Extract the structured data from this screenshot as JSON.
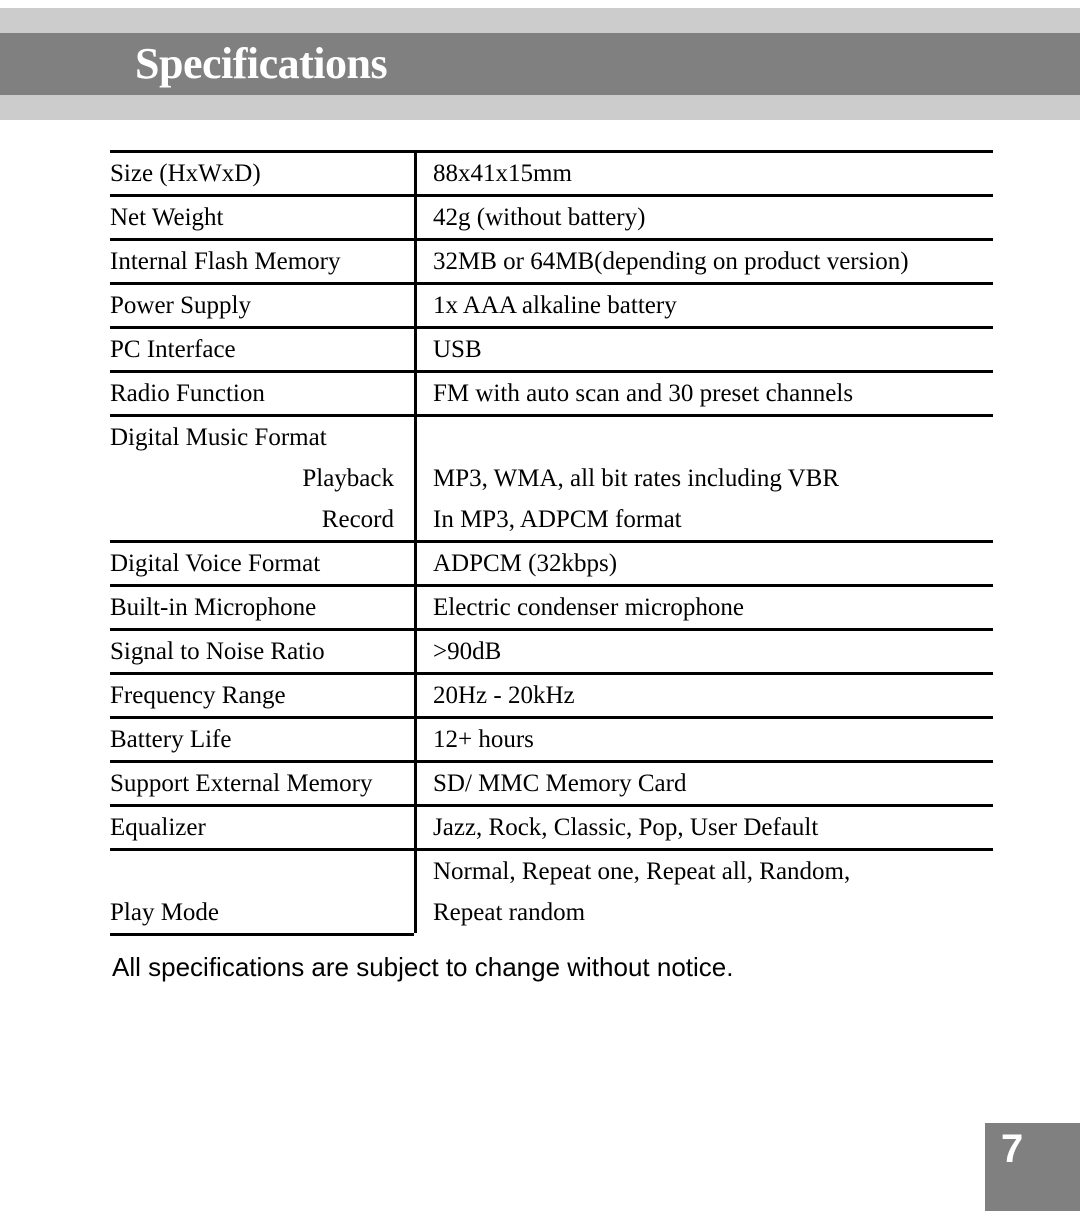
{
  "header": {
    "title": "Specifications",
    "band_light_color": "#cccccc",
    "band_dark_color": "#808080",
    "title_color": "#ffffff"
  },
  "spec_table": {
    "rows": [
      {
        "label": "Size (HxWxD)",
        "value": "88x41x15mm"
      },
      {
        "label": "Net Weight",
        "value": "42g (without battery)"
      },
      {
        "label": "Internal Flash Memory",
        "value": "32MB or  64MB(depending on product version)"
      },
      {
        "label": "Power Supply",
        "value": "1x AAA alkaline battery"
      },
      {
        "label": "PC Interface",
        "value": "USB"
      },
      {
        "label": "Radio Function",
        "value": "FM with auto scan and 30 preset channels"
      }
    ],
    "music_block": {
      "label": "Digital Music Format",
      "sub_labels": [
        "Playback",
        "Record"
      ],
      "sub_values": [
        "MP3, WMA, all bit rates including VBR",
        "In MP3, ADPCM format"
      ]
    },
    "rows_mid": [
      {
        "label": "Digital Voice Format",
        "value": "ADPCM (32kbps)"
      },
      {
        "label": "Built-in Microphone",
        "value": "Electric condenser microphone"
      },
      {
        "label": "Signal to Noise Ratio",
        "value": ">90dB"
      },
      {
        "label": "Frequency Range",
        "value": "20Hz - 20kHz"
      },
      {
        "label": "Battery Life",
        "value": "12+ hours"
      },
      {
        "label": "Support External Memory",
        "value": "SD/ MMC Memory Card"
      },
      {
        "label": "Equalizer",
        "value": "Jazz, Rock, Classic, Pop, User Default"
      }
    ],
    "play_mode": {
      "label": "Play Mode",
      "value_lines": [
        "Normal, Repeat one, Repeat all, Random,",
        "Repeat random"
      ]
    }
  },
  "footer": {
    "note": "All specifications are subject to change without notice."
  },
  "page_number": {
    "value": "7",
    "box_color": "#808080",
    "text_color": "#ffffff"
  }
}
